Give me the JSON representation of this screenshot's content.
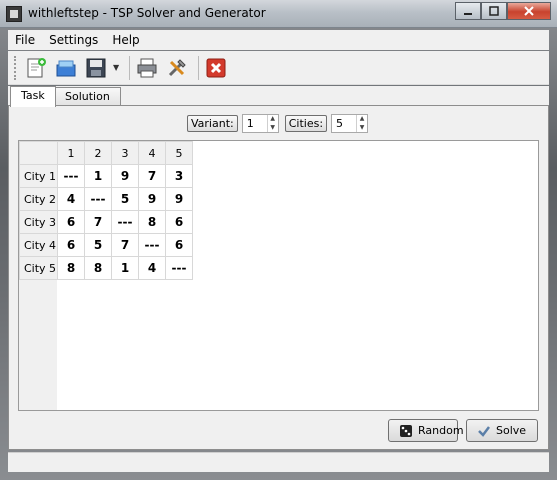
{
  "window": {
    "title": "withleftstep - TSP Solver and Generator"
  },
  "menu": [
    "File",
    "Settings",
    "Help"
  ],
  "toolbar": {
    "icons": [
      "new-document-icon",
      "open-icon",
      "save-icon",
      "print-icon",
      "tools-icon",
      "exit-icon"
    ]
  },
  "tabs": [
    "Task",
    "Solution"
  ],
  "params": {
    "variant_label": "Variant:",
    "variant_value": "1",
    "cities_label": "Cities:",
    "cities_value": "5"
  },
  "matrix": {
    "columns": [
      "1",
      "2",
      "3",
      "4",
      "5"
    ],
    "rows": [
      {
        "label": "City 1",
        "cells": [
          "---",
          "1",
          "9",
          "7",
          "3"
        ]
      },
      {
        "label": "City 2",
        "cells": [
          "4",
          "---",
          "5",
          "9",
          "9"
        ]
      },
      {
        "label": "City 3",
        "cells": [
          "6",
          "7",
          "---",
          "8",
          "6"
        ]
      },
      {
        "label": "City 4",
        "cells": [
          "6",
          "5",
          "7",
          "---",
          "6"
        ]
      },
      {
        "label": "City 5",
        "cells": [
          "8",
          "8",
          "1",
          "4",
          "---"
        ]
      }
    ]
  },
  "buttons": {
    "random": "Random",
    "solve": "Solve"
  }
}
